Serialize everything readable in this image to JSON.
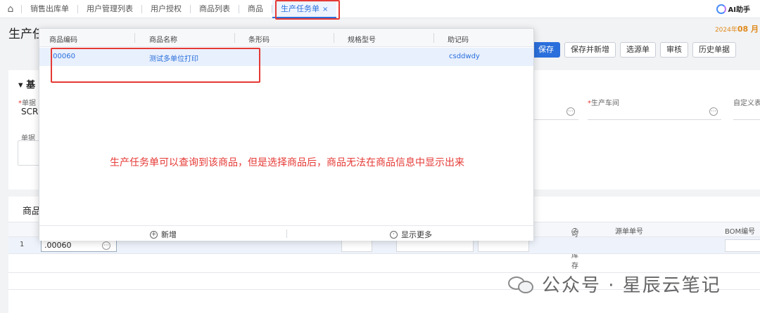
{
  "topbar": {
    "tabs": [
      "销售出库单",
      "用户管理列表",
      "用户授权",
      "商品列表",
      "商品"
    ],
    "active_tab": "生产任务单",
    "ai_label": "AI助手"
  },
  "page": {
    "title": "生产任",
    "date_prefix": "2024年",
    "date_emph": "08 月"
  },
  "toolbar": [
    "保存",
    "保存并新增",
    "选源单",
    "审核",
    "历史单据"
  ],
  "basic": {
    "section_title": "基",
    "doc_label": "单据",
    "doc_value": "SCR",
    "workshop_label": "生产车间",
    "custom_label": "自定义表",
    "remark_label": "单据"
  },
  "goods": {
    "title": "商品",
    "headers": {
      "available_stock": "可用库存",
      "source_no": "源单单号",
      "bom_no": "BOM编号"
    },
    "row_num": "1",
    "code_value": ".00060"
  },
  "popup": {
    "columns": [
      "商品编码",
      "商品名称",
      "条形码",
      "规格型号",
      "助记码"
    ],
    "row": {
      "code": ".00060",
      "name": "测试多单位打印",
      "barcode": "",
      "spec": "",
      "mnemonic": "csddwdy"
    },
    "annotation": "生产任务单可以查询到该商品，但是选择商品后，商品无法在商品信息中显示出来",
    "footer_new": "新增",
    "footer_more": "显示更多"
  },
  "watermark": "公众号 · 星辰云笔记",
  "colors": {
    "accent": "#2a6fdb",
    "highlight_red": "#e53935"
  }
}
